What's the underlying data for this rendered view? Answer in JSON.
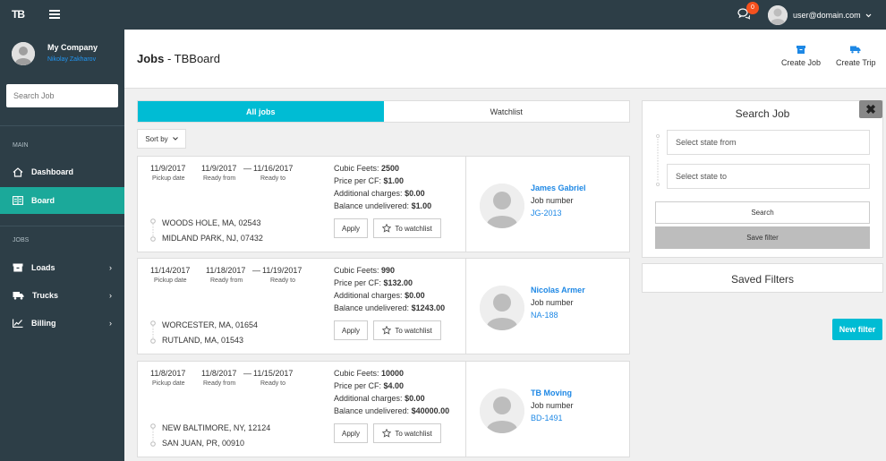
{
  "topbar": {
    "logo": "TB",
    "chat_count": "0",
    "user_email": "user@domain.com"
  },
  "sidebar": {
    "company": "My Company",
    "user_name": "Nikolay Zakharov",
    "search_placeholder": "Search Job",
    "section_main": "MAIN",
    "section_jobs": "JOBS",
    "items": [
      {
        "label": "Dashboard",
        "icon": "home-icon"
      },
      {
        "label": "Board",
        "icon": "board-icon",
        "active": true
      },
      {
        "label": "Loads",
        "icon": "box-icon"
      },
      {
        "label": "Trucks",
        "icon": "truck-icon"
      },
      {
        "label": "Billing",
        "icon": "chart-icon"
      }
    ]
  },
  "header": {
    "title_bold": "Jobs",
    "title_rest": " - TBBoard",
    "create_job": "Create Job",
    "create_trip": "Create Trip",
    "accent": "#1e88e5"
  },
  "tabs": [
    {
      "label": "All jobs",
      "active": true
    },
    {
      "label": "Watchlist",
      "active": false
    }
  ],
  "sort_label": "Sort by",
  "labels": {
    "pickup": "Pickup date",
    "ready_from": "Ready from",
    "ready_to": "Ready to",
    "cubic": "Cubic Feets: ",
    "price": "Price per CF: ",
    "additional": "Additional charges: ",
    "balance": "Balance undelivered: ",
    "apply": "Apply",
    "watch": "To watchlist",
    "job_number": "Job number",
    "dash": "—"
  },
  "jobs": [
    {
      "pickup": "11/9/2017",
      "from": "11/9/2017",
      "to": "11/16/2017",
      "origin": "WOODS HOLE, MA, 02543",
      "dest": "MIDLAND PARK, NJ, 07432",
      "cubic": "2500",
      "price": "$1.00",
      "additional": "$0.00",
      "balance": "$1.00",
      "name": "James Gabriel",
      "number": "JG-2013"
    },
    {
      "pickup": "11/14/2017",
      "from": "11/18/2017",
      "to": "11/19/2017",
      "origin": "WORCESTER, MA, 01654",
      "dest": "RUTLAND, MA, 01543",
      "cubic": "990",
      "price": "$132.00",
      "additional": "$0.00",
      "balance": "$1243.00",
      "name": "Nicolas Armer",
      "number": "NA-188"
    },
    {
      "pickup": "11/8/2017",
      "from": "11/8/2017",
      "to": "11/15/2017",
      "origin": "NEW BALTIMORE, NY, 12124",
      "dest": "SAN JUAN, PR, 00910",
      "cubic": "10000",
      "price": "$4.00",
      "additional": "$0.00",
      "balance": "$40000.00",
      "name": "TB Moving",
      "number": "BD-1491"
    }
  ],
  "search_panel": {
    "title": "Search Job",
    "close": "✖",
    "state_from_placeholder": "Select state from",
    "state_to_placeholder": "Select state to",
    "search_btn": "Search",
    "save_btn": "Save filter"
  },
  "saved_filters": {
    "title": "Saved Filters",
    "new_filter": "New filter"
  }
}
